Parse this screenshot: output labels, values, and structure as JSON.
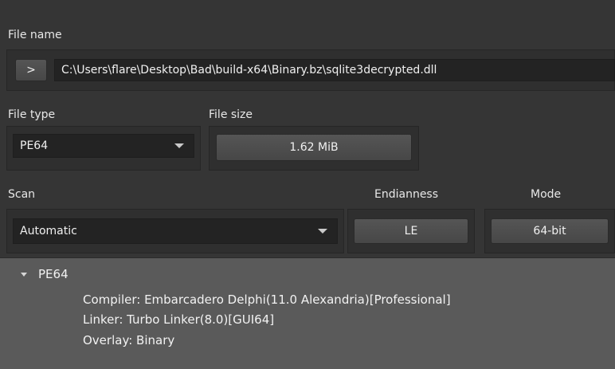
{
  "file_name": {
    "label": "File name",
    "open_button_label": ">",
    "path": "C:\\Users\\flare\\Desktop\\Bad\\build-x64\\Binary.bz\\sqlite3decrypted.dll"
  },
  "file_type": {
    "label": "File type",
    "selected": "PE64"
  },
  "file_size": {
    "label": "File size",
    "value": "1.62 MiB"
  },
  "scan": {
    "label": "Scan",
    "selected": "Automatic"
  },
  "endianness": {
    "label": "Endianness",
    "value": "LE"
  },
  "mode": {
    "label": "Mode",
    "value": "64-bit"
  },
  "results": {
    "root": "PE64",
    "items": [
      "Compiler: Embarcadero Delphi(11.0 Alexandria)[Professional]",
      "Linker: Turbo Linker(8.0)[GUI64]",
      "Overlay: Binary"
    ]
  }
}
